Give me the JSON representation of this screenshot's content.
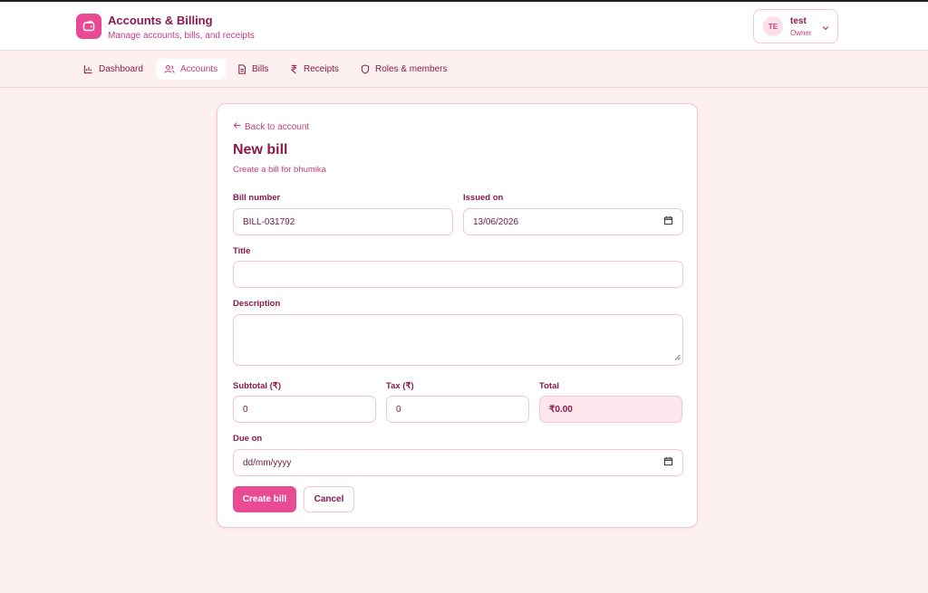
{
  "header": {
    "app_title": "Accounts & Billing",
    "app_subtitle": "Manage accounts, bills, and receipts",
    "logo_icon": "wallet-icon"
  },
  "user": {
    "initials": "TE",
    "name": "test",
    "role": "Owner"
  },
  "nav": {
    "tabs": [
      {
        "label": "Dashboard",
        "icon": "bar-chart-icon",
        "active": false
      },
      {
        "label": "Accounts",
        "icon": "users-icon",
        "active": true
      },
      {
        "label": "Bills",
        "icon": "document-icon",
        "active": false
      },
      {
        "label": "Receipts",
        "icon": "rupee-icon",
        "active": false
      },
      {
        "label": "Roles & members",
        "icon": "shield-icon",
        "active": false
      }
    ]
  },
  "form": {
    "back_label": "Back to account",
    "title": "New bill",
    "subtitle": "Create a bill for bhumika",
    "bill_number": {
      "label": "Bill number",
      "value": "BILL-031792"
    },
    "issued_on": {
      "label": "Issued on",
      "value": "13/06/2026"
    },
    "title_field": {
      "label": "Title",
      "value": ""
    },
    "description": {
      "label": "Description",
      "value": ""
    },
    "subtotal": {
      "label": "Subtotal (₹)",
      "value": "0"
    },
    "tax": {
      "label": "Tax (₹)",
      "value": "0"
    },
    "total": {
      "label": "Total",
      "value": "₹0.00"
    },
    "due_on": {
      "label": "Due on",
      "placeholder": "dd/mm/yyyy"
    },
    "submit_label": "Create bill",
    "cancel_label": "Cancel"
  },
  "colors": {
    "accent": "#e84b93",
    "background": "#fdf0f1",
    "text": "#8a1a4a",
    "muted_text": "#c2407a",
    "border": "#f3c6d6"
  }
}
